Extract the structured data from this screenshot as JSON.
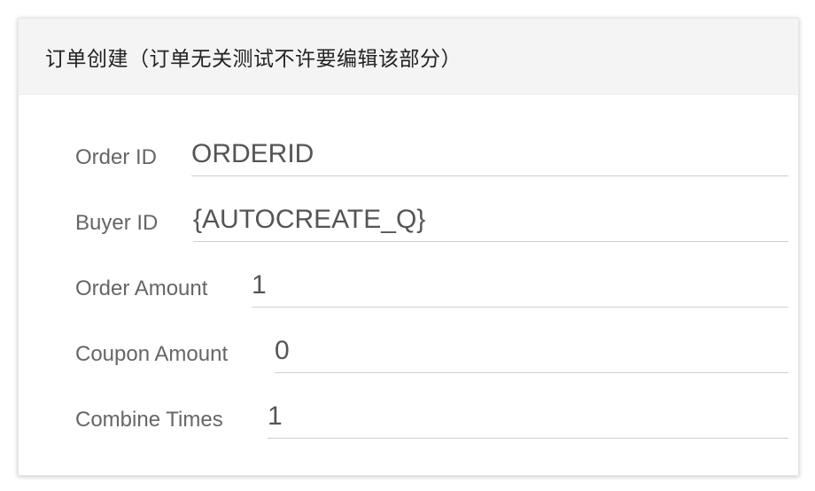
{
  "panel": {
    "title": "订单创建（订单无关测试不许要编辑该部分）"
  },
  "form": {
    "fields": [
      {
        "label": "Order ID",
        "value": "ORDERID"
      },
      {
        "label": "Buyer ID",
        "value": "{AUTOCREATE_Q}"
      },
      {
        "label": "Order Amount",
        "value": "1"
      },
      {
        "label": "Coupon Amount",
        "value": "0"
      },
      {
        "label": "Combine Times",
        "value": "1"
      }
    ]
  }
}
